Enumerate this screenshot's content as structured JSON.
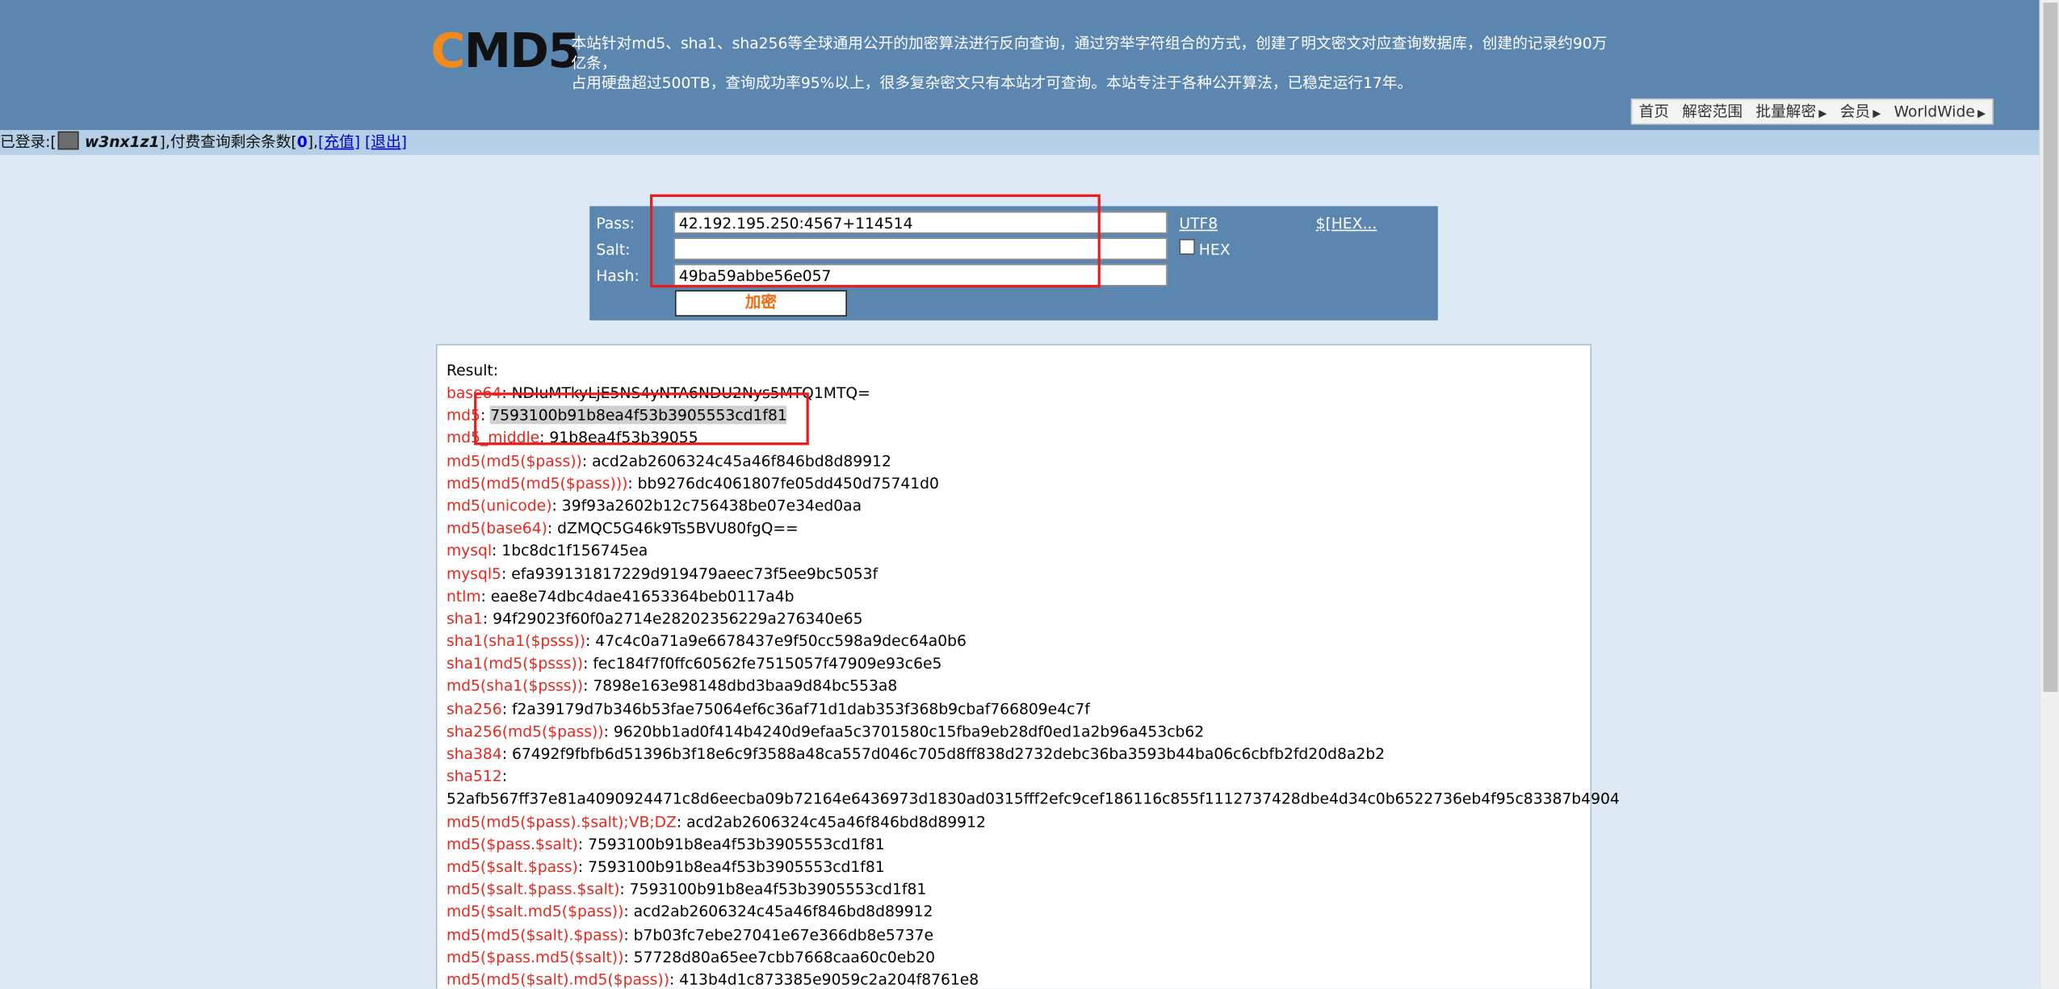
{
  "header": {
    "logo_c": "C",
    "logo_rest": "MD5",
    "tagline_line1": "本站针对md5、sha1、sha256等全球通用公开的加密算法进行反向查询，通过穷举字符组合的方式，创建了明文密文对应查询数据库，创建的记录约90万亿条，",
    "tagline_line2": "占用硬盘超过500TB，查询成功率95%以上，很多复杂密文只有本站才可查询。本站专注于各种公开算法，已稳定运行17年。"
  },
  "nav": {
    "items": [
      "首页",
      "解密范围",
      "批量解密",
      "会员",
      "WorldWide"
    ],
    "arrow": "▶"
  },
  "loginbar": {
    "prefix": "已登录:[",
    "username": "w3nx1z1",
    "mid": "],付费查询剩余条数[",
    "count": "0",
    "close": "],",
    "recharge": "[充值]",
    "logout": "[退出]"
  },
  "form": {
    "pass_label": "Pass:",
    "salt_label": "Salt:",
    "hash_label": "Hash:",
    "pass_value": "42.192.195.250:4567+114514",
    "salt_value": "",
    "hash_value": "49ba59abbe56e057",
    "utf8_link": "UTF8",
    "hex_link": "$[HEX...",
    "hex_checkbox_label": "HEX",
    "encrypt_button": "加密"
  },
  "result": {
    "header": "Result:",
    "rows": [
      {
        "k": "base64",
        "v": "NDIuMTkyLjE5NS4yNTA6NDU2Nys5MTQ1MTQ="
      },
      {
        "k": "md5",
        "v": "7593100b91b8ea4f53b3905553cd1f81"
      },
      {
        "k": "md5_middle",
        "v": "91b8ea4f53b39055"
      },
      {
        "k": "md5(md5($pass))",
        "v": "acd2ab2606324c45a46f846bd8d89912"
      },
      {
        "k": "md5(md5(md5($pass)))",
        "v": "bb9276dc4061807fe05dd450d75741d0"
      },
      {
        "k": "md5(unicode)",
        "v": "39f93a2602b12c756438be07e34ed0aa"
      },
      {
        "k": "md5(base64)",
        "v": "dZMQC5G46k9Ts5BVU80fgQ=="
      },
      {
        "k": "mysql",
        "v": "1bc8dc1f156745ea"
      },
      {
        "k": "mysql5",
        "v": "efa939131817229d919479aeec73f5ee9bc5053f"
      },
      {
        "k": "ntlm",
        "v": "eae8e74dbc4dae41653364beb0117a4b"
      },
      {
        "k": "sha1",
        "v": "94f29023f60f0a2714e28202356229a276340e65"
      },
      {
        "k": "sha1(sha1($psss))",
        "v": "47c4c0a71a9e6678437e9f50cc598a9dec64a0b6"
      },
      {
        "k": "sha1(md5($psss))",
        "v": "fec184f7f0ffc60562fe7515057f47909e93c6e5"
      },
      {
        "k": "md5(sha1($psss))",
        "v": "7898e163e98148dbd3baa9d84bc553a8"
      },
      {
        "k": "sha256",
        "v": "f2a39179d7b346b53fae75064ef6c36af71d1dab353f368b9cbaf766809e4c7f"
      },
      {
        "k": "sha256(md5($pass))",
        "v": "9620bb1ad0f414b4240d9efaa5c3701580c15fba9eb28df0ed1a2b96a453cb62"
      },
      {
        "k": "sha384",
        "v": "67492f9fbfb6d51396b3f18e6c9f3588a48ca557d046c705d8ff838d2732debc36ba3593b44ba06c6cbfb2fd20d8a2b2"
      },
      {
        "k": "sha512",
        "v": "52afb567ff37e81a4090924471c8d6eecba09b72164e6436973d1830ad0315fff2efc9cef186116c855f1112737428dbe4d34c0b6522736eb4f95c83387b4904"
      },
      {
        "k": "md5(md5($pass).$salt);VB;DZ",
        "v": "acd2ab2606324c45a46f846bd8d89912"
      },
      {
        "k": "md5($pass.$salt)",
        "v": "7593100b91b8ea4f53b3905553cd1f81"
      },
      {
        "k": "md5($salt.$pass)",
        "v": "7593100b91b8ea4f53b3905553cd1f81"
      },
      {
        "k": "md5($salt.$pass.$salt)",
        "v": "7593100b91b8ea4f53b3905553cd1f81"
      },
      {
        "k": "md5($salt.md5($pass))",
        "v": "acd2ab2606324c45a46f846bd8d89912"
      },
      {
        "k": "md5(md5($salt).$pass)",
        "v": "b7b03fc7ebe27041e67e366db8e5737e"
      },
      {
        "k": "md5($pass.md5($salt))",
        "v": "57728d80a65ee7cbb7668caa60c0eb20"
      },
      {
        "k": "md5(md5($salt).md5($pass))",
        "v": "413b4d1c873385e9059c2a204f8761e8"
      }
    ]
  },
  "colors": {
    "header_bg": "#5b86b0",
    "page_bg": "#ddeaf5",
    "loginbar_bg": "#b4cfe6",
    "key_red": "#e5281e",
    "logo_orange": "#f28a1e",
    "button_text": "#f26c12",
    "annotation_red": "#ea1d1d"
  }
}
